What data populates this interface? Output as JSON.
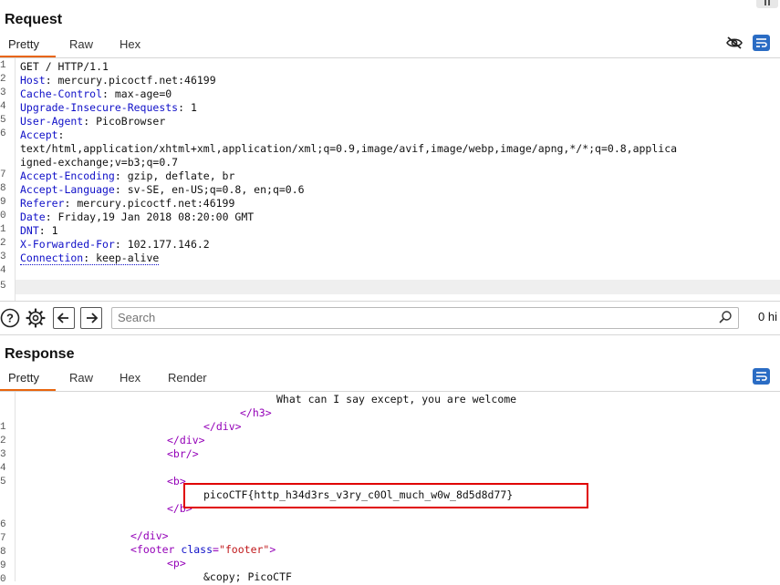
{
  "request": {
    "title": "Request",
    "tabs": [
      "Pretty",
      "Raw",
      "Hex"
    ],
    "active_tab": "Pretty",
    "line_numbers": [
      "1",
      "2",
      "3",
      "4",
      "5",
      "6",
      "7",
      "8",
      "9",
      "0",
      "1",
      "2",
      "3",
      "4",
      "5"
    ],
    "lines": [
      {
        "name": "",
        "value": "GET / HTTP/1.1"
      },
      {
        "name": "Host",
        "value": ": mercury.picoctf.net:46199"
      },
      {
        "name": "Cache-Control",
        "value": ": max-age=0"
      },
      {
        "name": "Upgrade-Insecure-Requests",
        "value": ": 1"
      },
      {
        "name": "User-Agent",
        "value": ": PicoBrowser"
      },
      {
        "name": "Accept",
        "value": ":"
      },
      {
        "name": "",
        "value": "text/html,application/xhtml+xml,application/xml;q=0.9,image/avif,image/webp,image/apng,*/*;q=0.8,applica"
      },
      {
        "name": "",
        "value": "igned-exchange;v=b3;q=0.7"
      },
      {
        "name": "Accept-Encoding",
        "value": ": gzip, deflate, br"
      },
      {
        "name": "Accept-Language",
        "value": ": sv-SE, en-US;q=0.8, en;q=0.6"
      },
      {
        "name": "Referer",
        "value": ": mercury.picoctf.net:46199"
      },
      {
        "name": "Date",
        "value": ": Friday,19 Jan 2018 08:20:00 GMT"
      },
      {
        "name": "DNT",
        "value": ": 1"
      },
      {
        "name": "X-Forwarded-For",
        "value": ": 102.177.146.2"
      },
      {
        "name": "Connection",
        "value": ": keep-alive"
      }
    ],
    "gutter_numbers": [
      "1",
      "2",
      "3",
      "4",
      "5",
      "6",
      "",
      "",
      "7",
      "8",
      "9",
      "0",
      "1",
      "2",
      "3",
      "4",
      "5"
    ]
  },
  "search": {
    "placeholder": "Search",
    "hits_label": "0 hi"
  },
  "response": {
    "title": "Response",
    "tabs": [
      "Pretty",
      "Raw",
      "Hex",
      "Render"
    ],
    "active_tab": "Pretty",
    "text_line": "What can I say except, you are welcome",
    "close_h3": "</h3>",
    "close_div1": "</div>",
    "close_div2": "</div>",
    "br": "<br/>",
    "open_b": "<b>",
    "flag": "picoCTF{http_h34d3rs_v3ry_c0Ol_much_w0w_8d5d8d77}",
    "close_b": "</b>",
    "close_div3": "</div>",
    "footer_open_tag": "<footer ",
    "footer_attr": "class",
    "footer_eq": "=",
    "footer_val": "\"footer\"",
    "footer_close": ">",
    "p_open": "<p>",
    "copy": "&copy; PicoCTF",
    "gutter": [
      "",
      "",
      "1",
      "2",
      "3",
      "4",
      "5",
      "",
      "6",
      "7",
      "8",
      "9",
      "0"
    ]
  },
  "colors": {
    "accent_tab": "#e8650d",
    "highlight_box": "#e00000",
    "header_name": "#1010c8",
    "tag": "#9400b8",
    "string": "#c0181b"
  }
}
